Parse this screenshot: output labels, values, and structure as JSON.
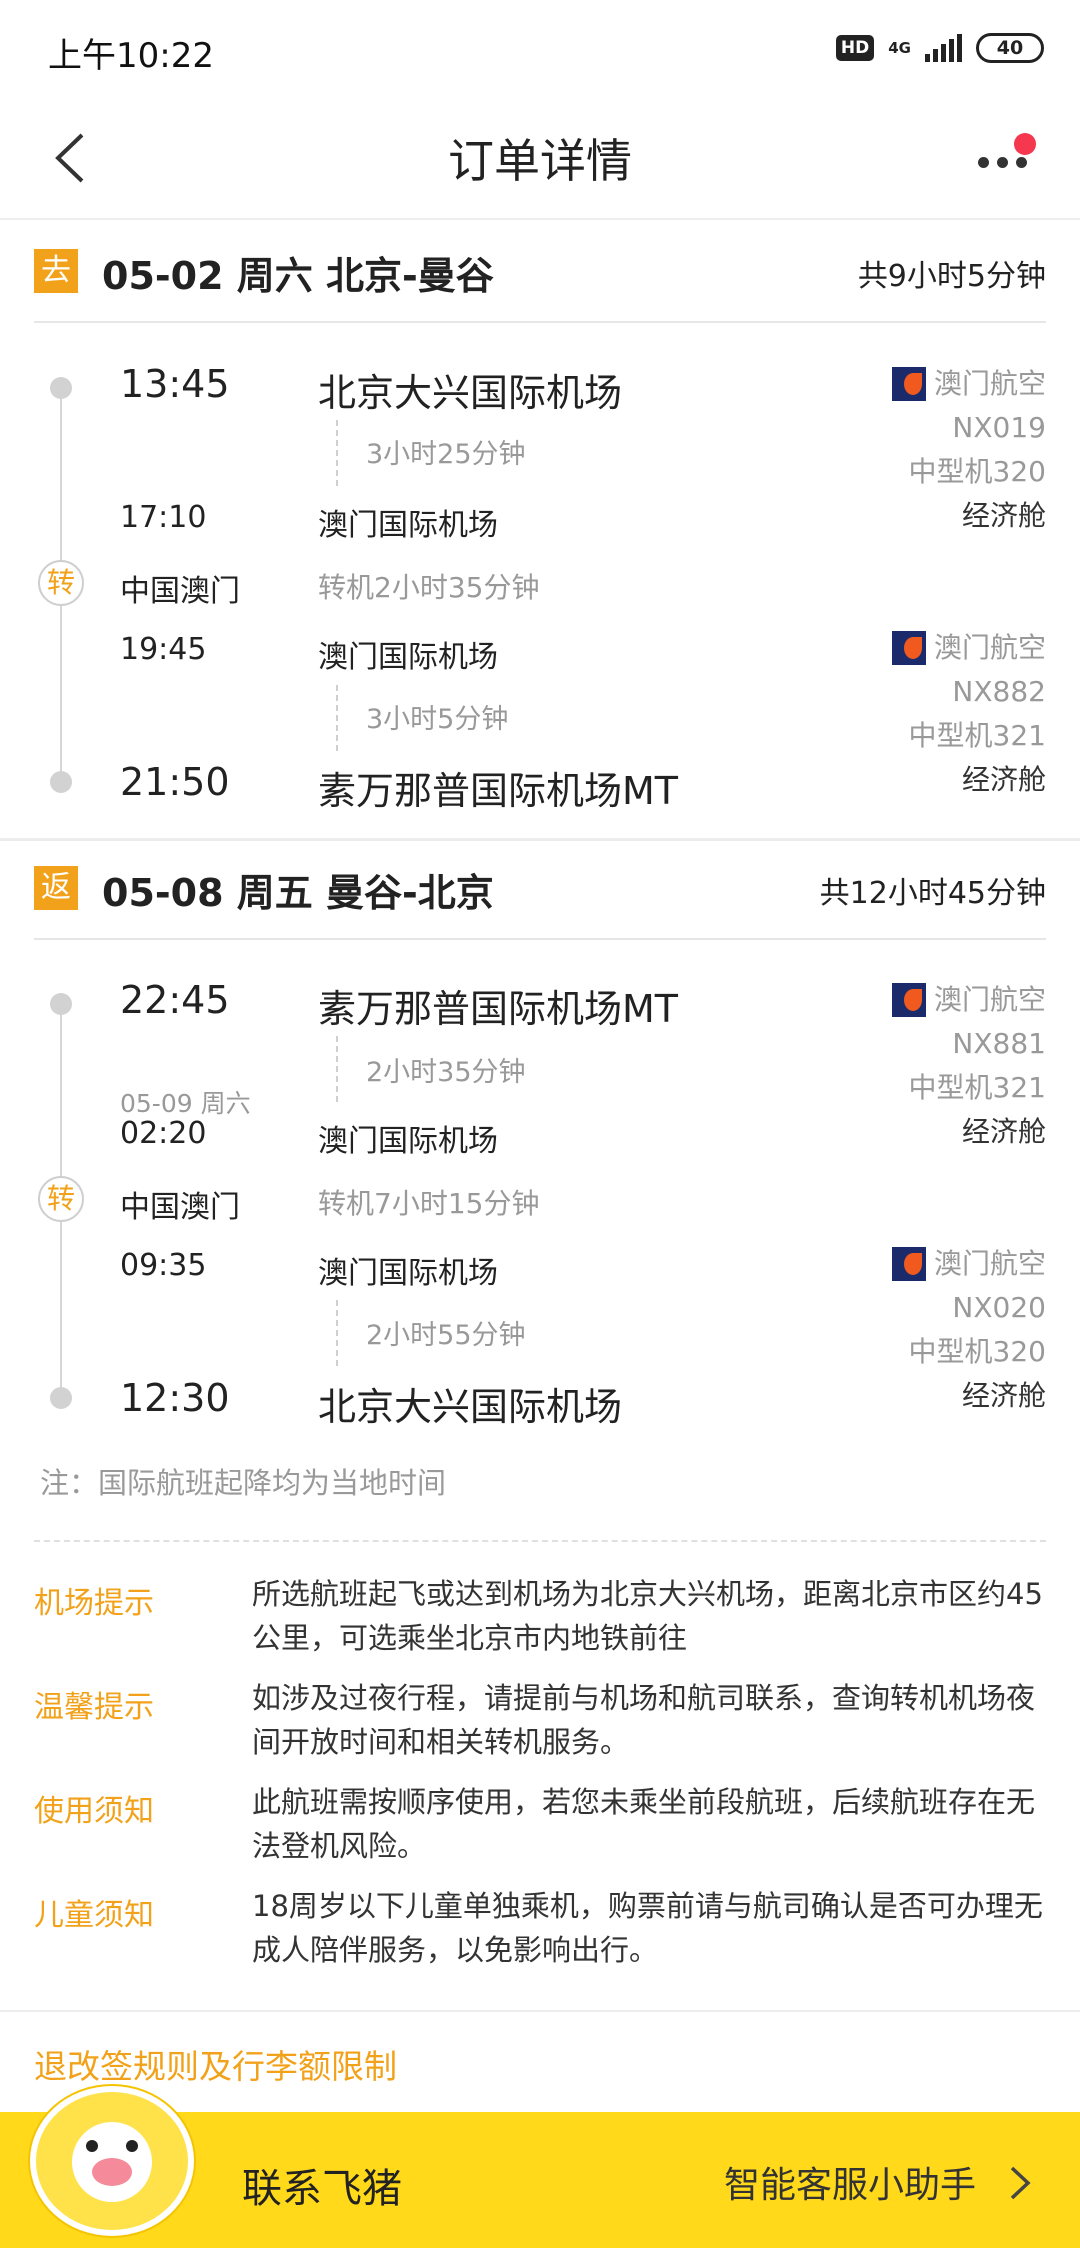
{
  "status_bar": {
    "time": "上午10:22",
    "hd": "HD",
    "network": "4G",
    "battery": "40"
  },
  "header": {
    "title": "订单详情"
  },
  "outbound": {
    "badge": "去",
    "title": "05-02 周六 北京-曼谷",
    "total": "共9小时5分钟",
    "seg1": {
      "dep_time": "13:45",
      "dep_airport": "北京大兴国际机场",
      "duration": "3小时25分钟",
      "arr_time": "17:10",
      "arr_airport": "澳门国际机场",
      "airline": "澳门航空",
      "flight": "NX019",
      "aircraft": "中型机320",
      "cabin": "经济舱"
    },
    "transfer": {
      "icon": "转",
      "city": "中国澳门",
      "duration": "转机2小时35分钟"
    },
    "seg2": {
      "dep_time": "19:45",
      "dep_airport": "澳门国际机场",
      "duration": "3小时5分钟",
      "arr_time": "21:50",
      "arr_airport": "素万那普国际机场MT",
      "airline": "澳门航空",
      "flight": "NX882",
      "aircraft": "中型机321",
      "cabin": "经济舱"
    }
  },
  "return": {
    "badge": "返",
    "title": "05-08 周五 曼谷-北京",
    "total": "共12小时45分钟",
    "seg1": {
      "dep_time": "22:45",
      "dep_airport": "素万那普国际机场MT",
      "duration": "2小时35分钟",
      "arr_date": "05-09 周六",
      "arr_time": "02:20",
      "arr_airport": "澳门国际机场",
      "airline": "澳门航空",
      "flight": "NX881",
      "aircraft": "中型机321",
      "cabin": "经济舱"
    },
    "transfer": {
      "icon": "转",
      "city": "中国澳门",
      "duration": "转机7小时15分钟"
    },
    "seg2": {
      "dep_time": "09:35",
      "dep_airport": "澳门国际机场",
      "duration": "2小时55分钟",
      "arr_time": "12:30",
      "arr_airport": "北京大兴国际机场",
      "airline": "澳门航空",
      "flight": "NX020",
      "aircraft": "中型机320",
      "cabin": "经济舱"
    }
  },
  "note": "注：国际航班起降均为当地时间",
  "tips": [
    {
      "label": "机场提示",
      "text": "所选航班起飞或达到机场为北京大兴机场，距离北京市区约45公里，可选乘坐北京市内地铁前往"
    },
    {
      "label": "温馨提示",
      "text": "如涉及过夜行程，请提前与机场和航司联系，查询转机机场夜间开放时间和相关转机服务。"
    },
    {
      "label": "使用须知",
      "text": "此航班需按顺序使用，若您未乘坐前段航班，后续航班存在无法登机风险。"
    },
    {
      "label": "儿童须知",
      "text": "18周岁以下儿童单独乘机，购票前请与航司确认是否可办理无成人陪伴服务，以免影响出行。"
    }
  ],
  "rules_link": "退改签规则及行李额限制",
  "bottom": {
    "contact": "联系飞猪",
    "assistant": "智能客服小助手"
  },
  "colors": {
    "accent": "#f2a21a",
    "bar": "#ffd91a",
    "notification": "#f5374f"
  }
}
